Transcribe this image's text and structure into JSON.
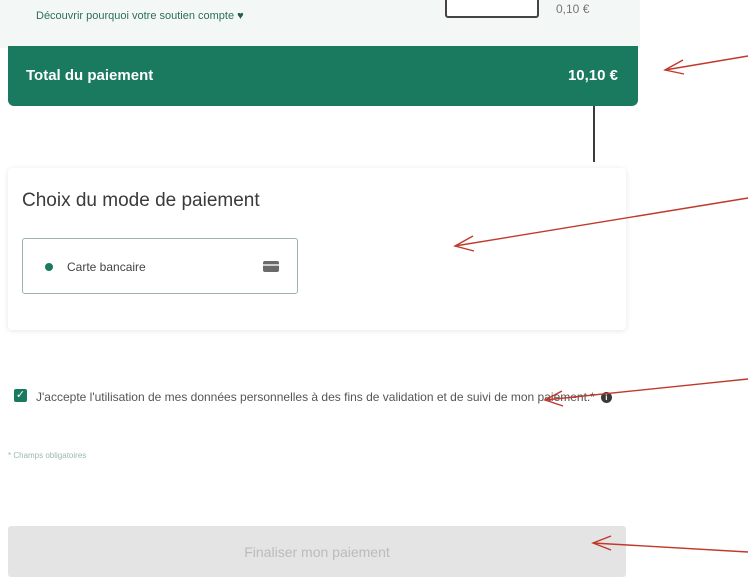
{
  "support": {
    "link_text": "Découvrir pourquoi votre soutien compte",
    "donation_amount": "0,10 €"
  },
  "total": {
    "label": "Total du paiement",
    "value": "10,10 €"
  },
  "payment_method": {
    "title": "Choix du mode de paiement",
    "option_label": "Carte bancaire",
    "option_selected": true
  },
  "consent": {
    "text": "J'accepte l'utilisation de mes données personnelles à des fins de validation et de suivi de mon paiement.*",
    "checked": true
  },
  "mandatory_note": "* Champs obligatoires",
  "finalize_label": "Finaliser mon paiement",
  "colors": {
    "brand_green": "#1a7a5f",
    "annotation_arrow": "#c0392b",
    "disabled_button": "#e4e4e4"
  }
}
